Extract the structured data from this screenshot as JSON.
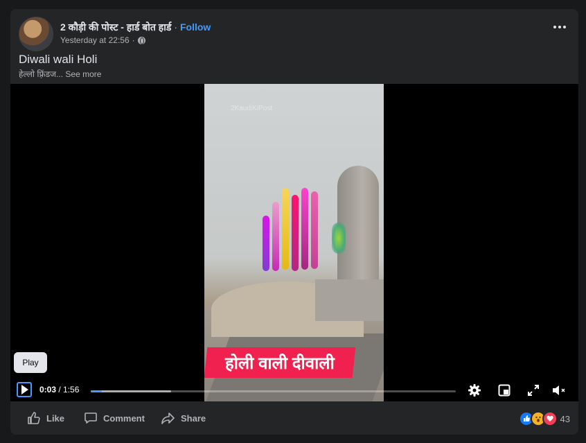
{
  "post": {
    "page_name": "2 कौड़ी की पोस्ट - हार्ड बोत हार्ड",
    "separator": "·",
    "follow_label": "Follow",
    "timestamp": "Yesterday at 22:56",
    "meta_separator": "·",
    "audience_icon": "globe-icon",
    "more_icon": "more-options-icon",
    "title": "Diwali wali Holi",
    "description_preview": "हेल्लो फ़्रिंडज...",
    "see_more_label": "See more"
  },
  "video": {
    "banner_text": "होली वाली दीवाली",
    "watermark_text": "2KaudiKiPost",
    "tooltip": "Play",
    "current_time": "0:03",
    "time_separator": " / ",
    "duration": "1:56",
    "progress_played_fraction": 0.03,
    "progress_buffered_fraction": 0.22,
    "icons": [
      "play-icon",
      "settings-icon",
      "picture-in-picture-icon",
      "fullscreen-icon",
      "mute-icon"
    ]
  },
  "actions": {
    "like_label": "Like",
    "comment_label": "Comment",
    "share_label": "Share"
  },
  "reactions": {
    "types": [
      "like",
      "wow",
      "love"
    ],
    "count": "43"
  },
  "colors": {
    "background": "#18191a",
    "card": "#242526",
    "accent": "#4599ff",
    "banner": "#f0214f"
  }
}
